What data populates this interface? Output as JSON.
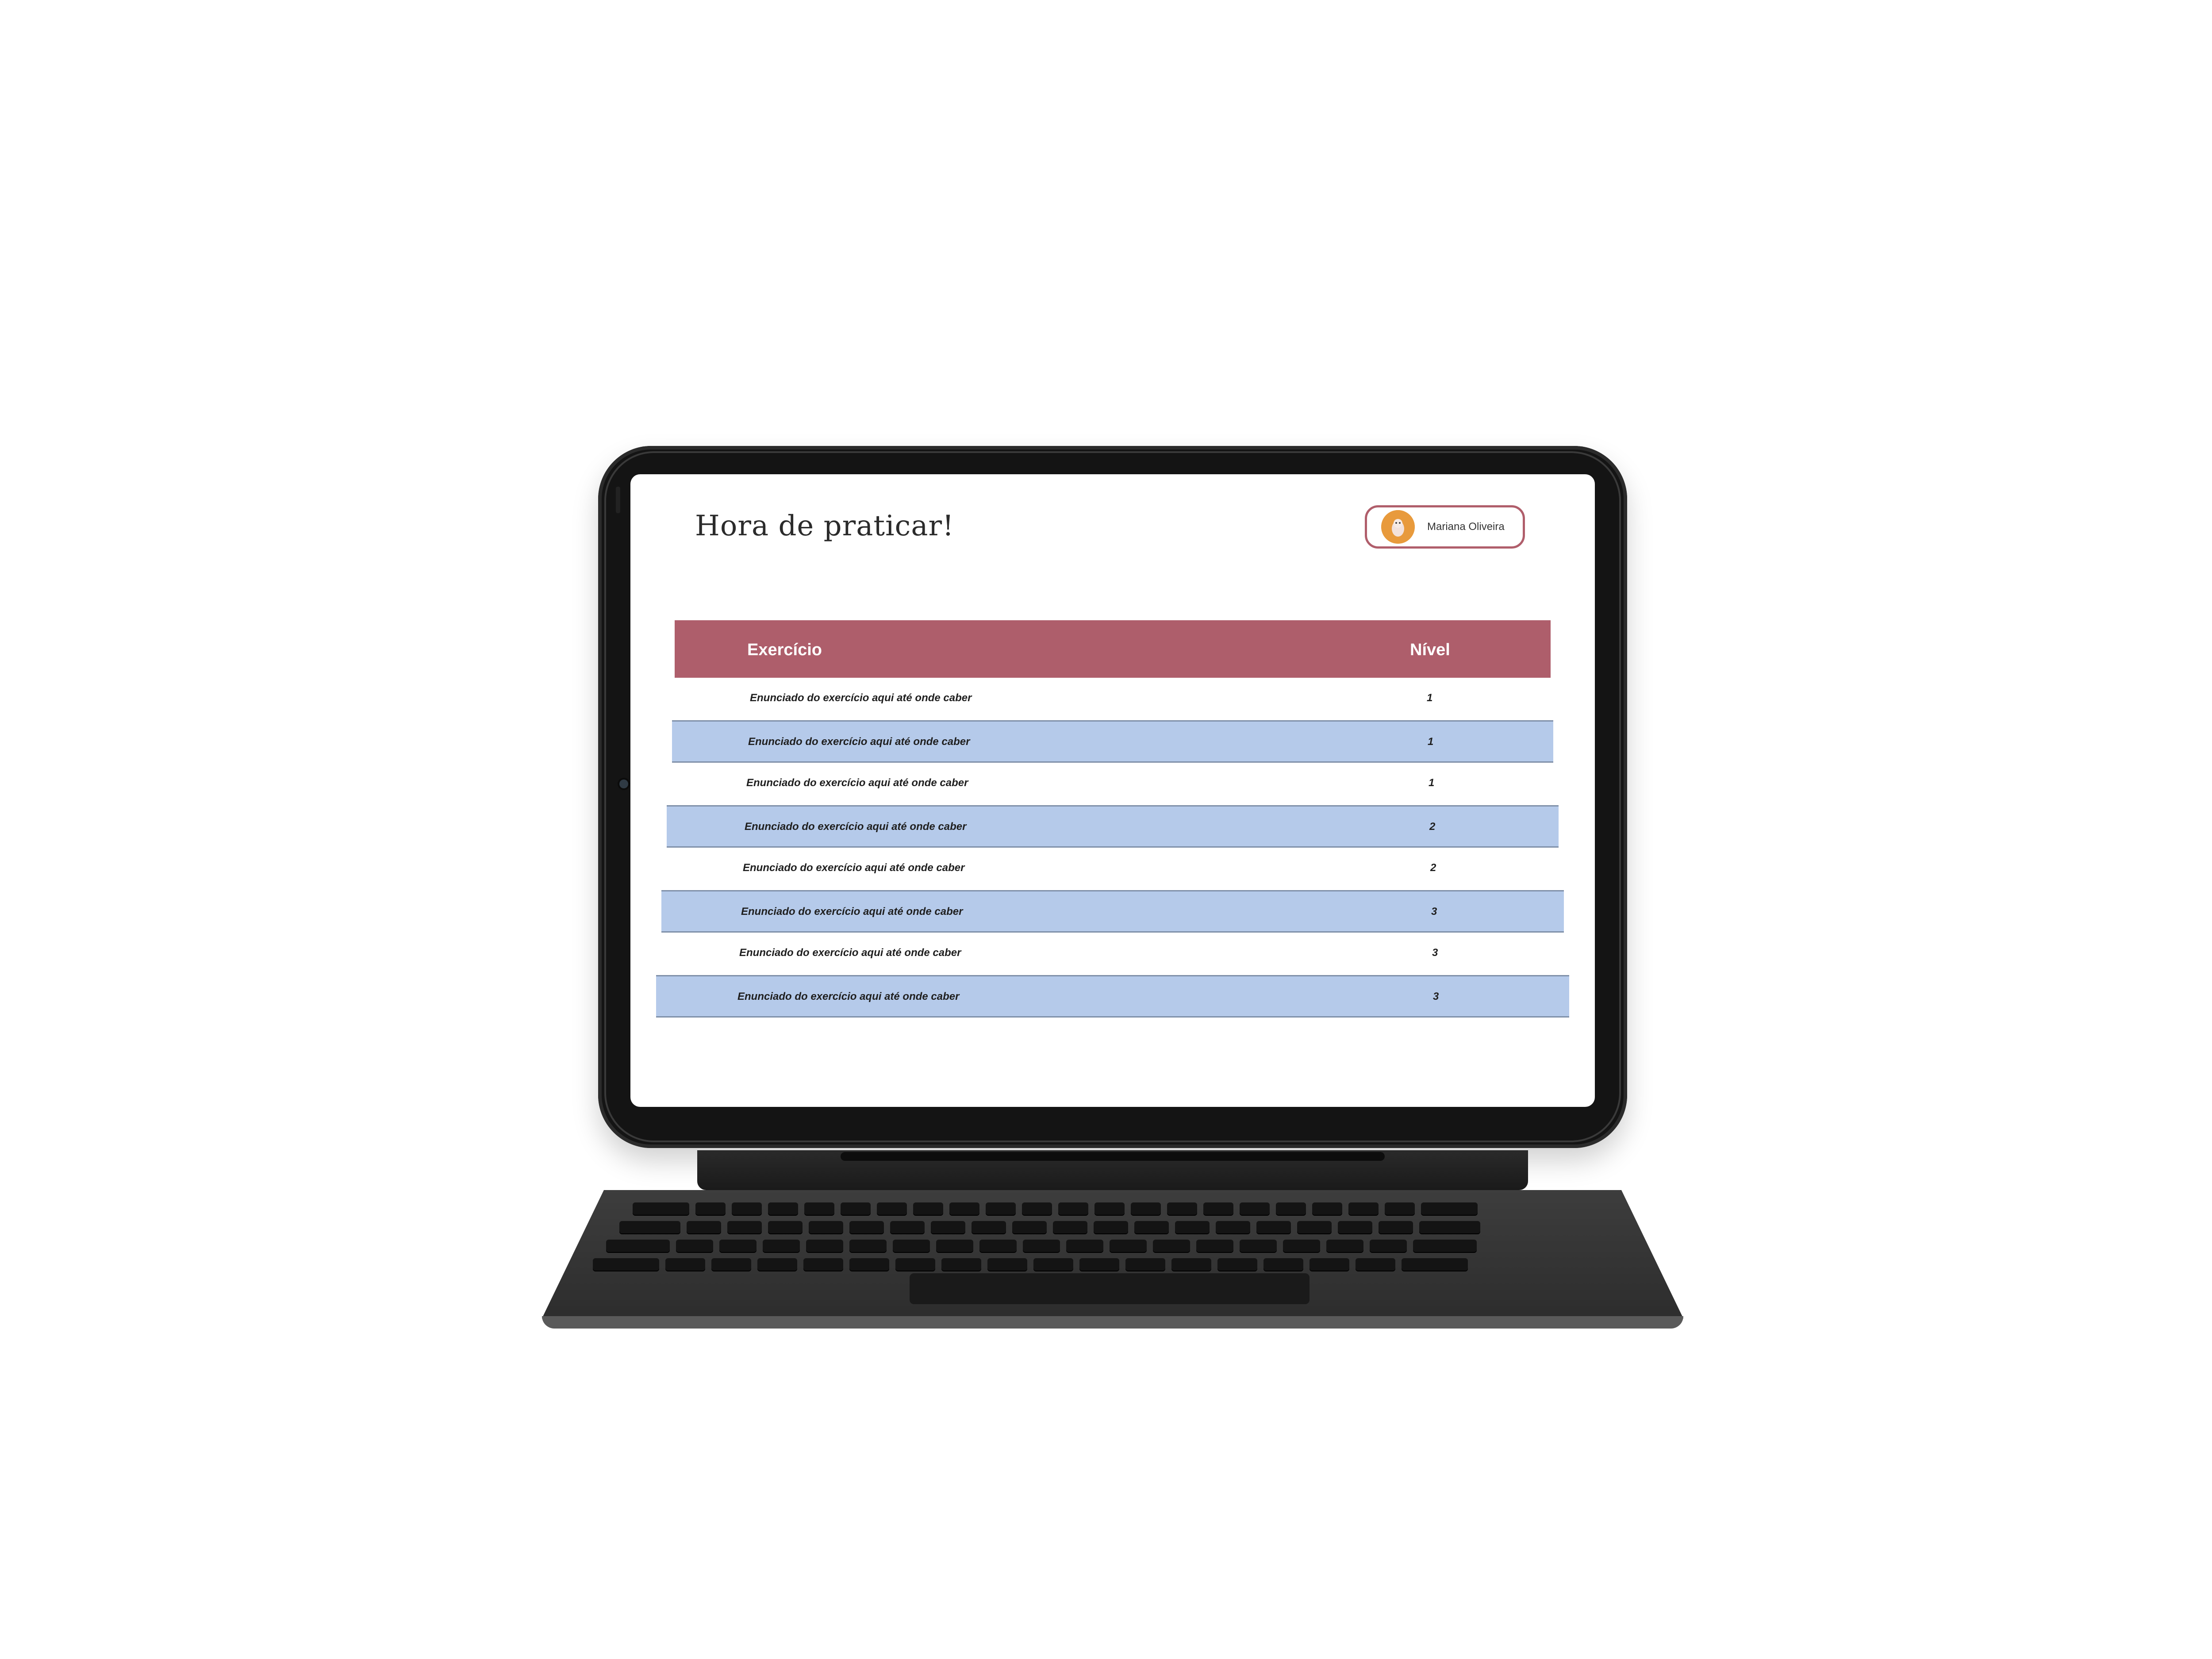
{
  "page": {
    "title": "Hora de praticar!"
  },
  "user": {
    "name": "Mariana Oliveira",
    "avatar_icon": "avatar-icon",
    "accent": "#b05e6b"
  },
  "table": {
    "header_color": "#ae5e6b",
    "stripe_color": "#b5caea",
    "columns": [
      "Exercício",
      "Nível"
    ],
    "rows": [
      {
        "text": "Enunciado do exercício aqui até onde caber",
        "level": "1"
      },
      {
        "text": "Enunciado do exercício aqui até onde caber",
        "level": "1"
      },
      {
        "text": "Enunciado do exercício aqui até onde caber",
        "level": "1"
      },
      {
        "text": "Enunciado do exercício aqui até onde caber",
        "level": "2"
      },
      {
        "text": "Enunciado do exercício aqui até onde caber",
        "level": "2"
      },
      {
        "text": "Enunciado do exercício aqui até onde caber",
        "level": "3"
      },
      {
        "text": "Enunciado do exercício aqui até onde caber",
        "level": "3"
      },
      {
        "text": "Enunciado do exercício aqui até onde caber",
        "level": "3"
      }
    ]
  }
}
